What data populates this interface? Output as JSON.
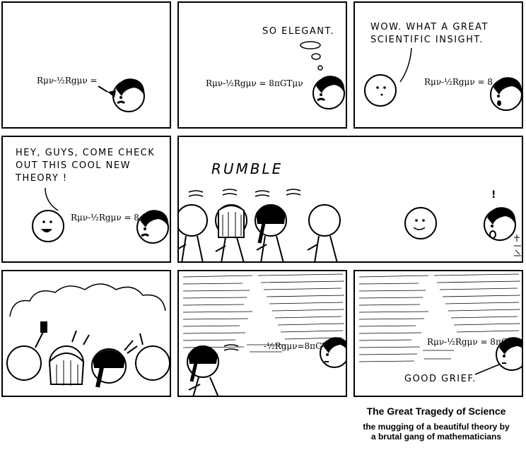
{
  "comic": {
    "equation_left": "Rμν-½Rgμν",
    "equation_full": "Rμν-½Rgμν = 8πGTμν",
    "equation_cut": "Rμν-½Rgμν = 8",
    "equation_mugged": "-½Rgμν=8πGTμν",
    "panel1": {
      "equation": "Rμν-½Rgμν ="
    },
    "panel2": {
      "thought": "SO ELEGANT."
    },
    "panel3": {
      "speech_line1": "WOW. WHAT A GREAT",
      "speech_line2": "SCIENTIFIC INSIGHT."
    },
    "panel4": {
      "speech_line1": "HEY, GUYS, COME CHECK",
      "speech_line2": "OUT THIS COOL NEW",
      "speech_line3": "THEORY !"
    },
    "panel5": {
      "sound": "RUMBLE",
      "exclaim": "!"
    },
    "panel9": {
      "speech": "GOOD GRIEF."
    }
  },
  "caption": {
    "title": "The Great Tragedy of Science",
    "subtitle_line1": "the mugging of a beautiful theory by",
    "subtitle_line2": "a brutal gang of mathematicians"
  }
}
